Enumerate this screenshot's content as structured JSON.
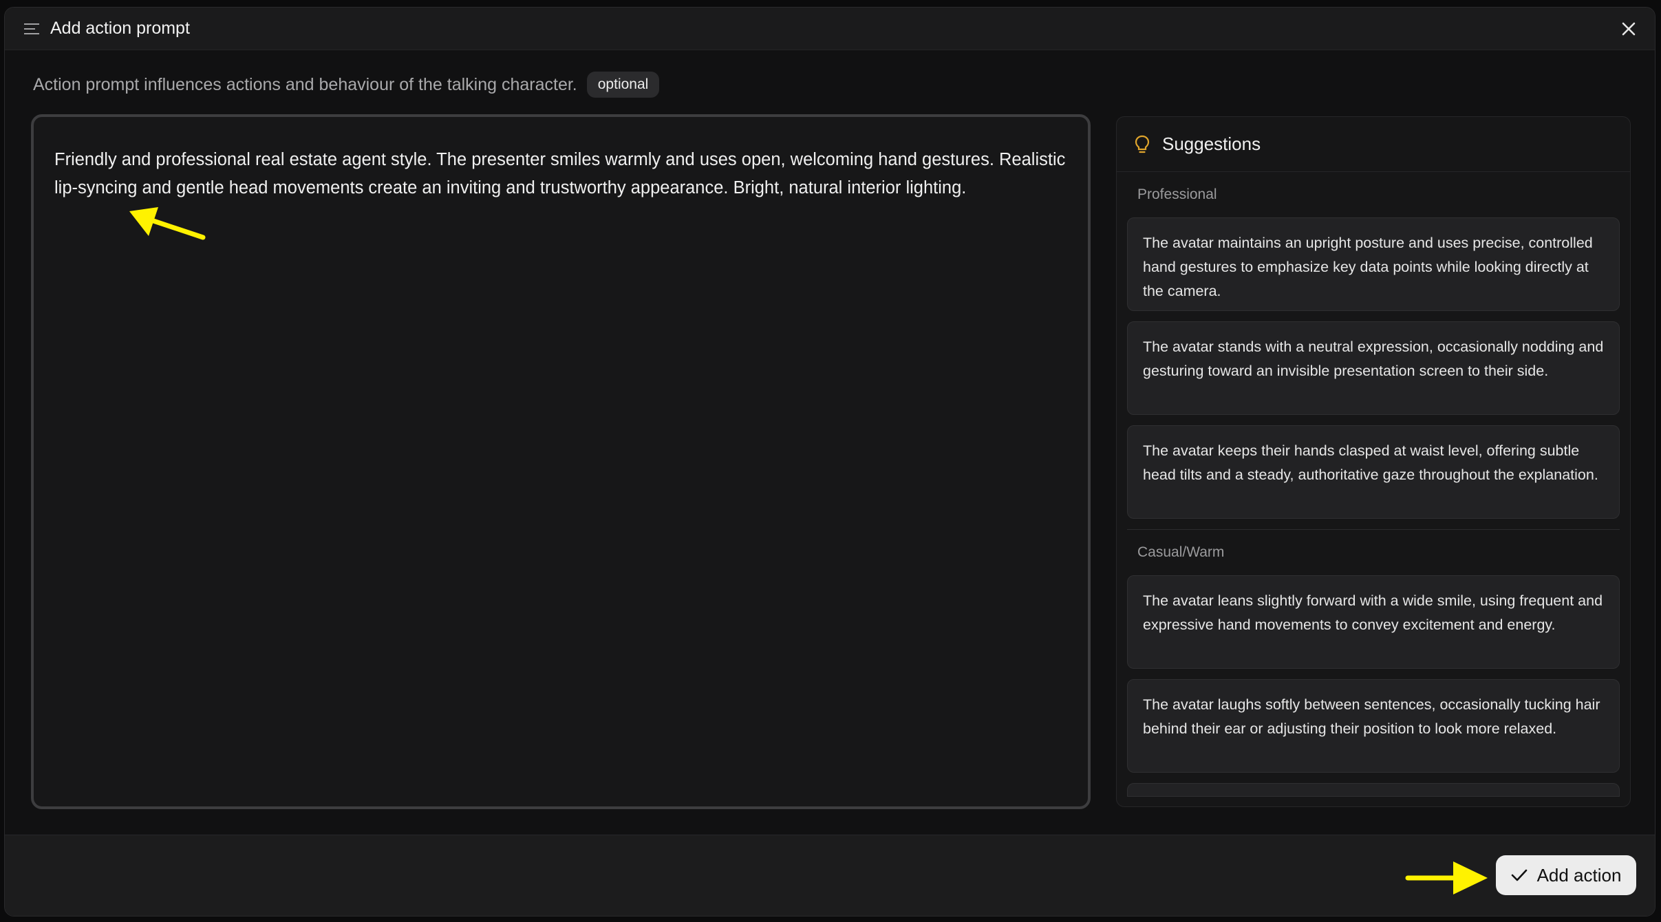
{
  "window": {
    "title": "Add action prompt"
  },
  "subtitle": {
    "text": "Action prompt influences actions and behaviour of the talking character.",
    "badge": "optional"
  },
  "prompt": {
    "value": "Friendly and professional real estate agent style. The presenter smiles warmly and uses open, welcoming hand gestures. Realistic lip-syncing and gentle head movements create an inviting and trustworthy appearance. Bright, natural interior lighting."
  },
  "suggestions": {
    "title": "Suggestions",
    "sections": [
      {
        "label": "Professional",
        "items": [
          "The avatar maintains an upright posture and uses precise, controlled hand gestures to emphasize key data points while looking directly at the camera.",
          "The avatar stands with a neutral expression, occasionally nodding and gesturing toward an invisible presentation screen to their side.",
          "The avatar keeps their hands clasped at waist level, offering subtle head tilts and a steady, authoritative gaze throughout the explanation."
        ]
      },
      {
        "label": "Casual/Warm",
        "items": [
          "The avatar leans slightly forward with a wide smile, using frequent and expressive hand movements to convey excitement and energy.",
          "The avatar laughs softly between sentences, occasionally tucking hair behind their ear or adjusting their position to look more relaxed."
        ]
      }
    ]
  },
  "footer": {
    "add_label": "Add action"
  },
  "colors": {
    "accent_bulb": "#e0a52c",
    "annotation_arrow": "#fff200"
  }
}
